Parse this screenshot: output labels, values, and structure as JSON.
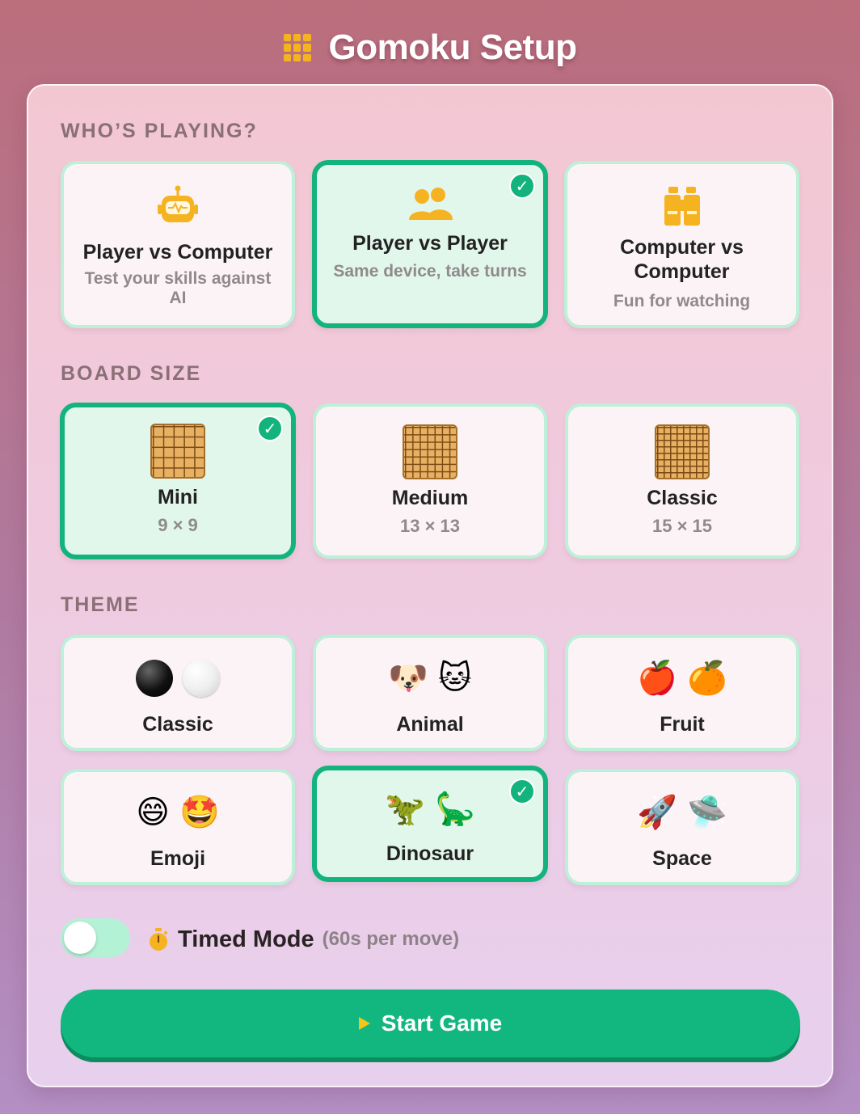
{
  "app": {
    "title": "Gomoku Setup",
    "title_icon": "grid-icon"
  },
  "sections": {
    "players": "WHO’S PLAYING?",
    "board": "BOARD SIZE",
    "theme": "THEME"
  },
  "modes": [
    {
      "title": "Player vs Computer",
      "subtitle": "Test your skills against AI",
      "icon": "robot-icon",
      "selected": false
    },
    {
      "title": "Player vs Player",
      "subtitle": "Same device, take turns",
      "icon": "people-icon",
      "selected": true
    },
    {
      "title": "Computer vs Computer",
      "subtitle": "Fun for watching",
      "icon": "binoculars-icon",
      "selected": false
    }
  ],
  "boards": [
    {
      "title": "Mini",
      "size": "9 × 9",
      "grid": 9,
      "selected": true
    },
    {
      "title": "Medium",
      "size": "13 × 13",
      "grid": 13,
      "selected": false
    },
    {
      "title": "Classic",
      "size": "15 × 15",
      "grid": 15,
      "selected": false
    }
  ],
  "themes": [
    {
      "title": "Classic",
      "icons": [
        "black-stone",
        "white-stone"
      ],
      "selected": false
    },
    {
      "title": "Animal",
      "icons": [
        "🐶",
        "🐱"
      ],
      "selected": false
    },
    {
      "title": "Fruit",
      "icons": [
        "🍎",
        "🍊"
      ],
      "selected": false
    },
    {
      "title": "Emoji",
      "icons": [
        "😄",
        "🤩"
      ],
      "selected": false
    },
    {
      "title": "Dinosaur",
      "icons": [
        "🦖",
        "🦕"
      ],
      "selected": true
    },
    {
      "title": "Space",
      "icons": [
        "🚀",
        "🛸"
      ],
      "selected": false
    }
  ],
  "timed": {
    "label": "Timed Mode",
    "hint": "(60s per move)",
    "icon": "stopwatch-icon",
    "enabled": false
  },
  "start": {
    "label": "Start Game",
    "icon": "play-icon"
  },
  "colors": {
    "accent": "#12b37d",
    "card_border": "#bdf0d8",
    "icon_yellow": "#f5b321"
  }
}
